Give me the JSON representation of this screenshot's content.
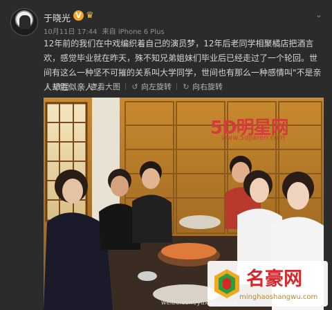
{
  "post": {
    "username": "于晓光",
    "verified_badge": "V",
    "timestamp": "10月11日 17:44",
    "source": "来自 iPhone 6 Plus",
    "content": "12年前的我们在中戏编织着自己的演员梦，12年后老同学相聚橘店把酒言欢，感觉毕业就在昨天，殊不知兄弟姐妹们毕业后已经走过了一个轮回。世间有这么一种坚不可摧的关系叫大学同学，世间也有那么一种感情叫\"不是亲人却胜似亲人\"。"
  },
  "toolbar": {
    "collapse": "收起",
    "view_large": "查看大图",
    "rotate_left": "向左旋转",
    "rotate_right": "向右旋转"
  },
  "icons": {
    "avatar": "user-avatar",
    "verified": "verified-v-badge",
    "crown": "crown-icon",
    "menu": "chevron-down-icon",
    "collapse": "collapse-icon",
    "zoom": "magnifier-icon",
    "rotate_left": "rotate-left-icon",
    "rotate_right": "rotate-right-icon"
  },
  "watermarks": {
    "site1_name": "5D明星网",
    "site1_url": "www.5djiaren.com",
    "site2_name": "名豪网",
    "site2_url": "minghaoshangwu.com",
    "weibo_caption": "weibo.com/yuxiaoguang"
  },
  "colors": {
    "background": "#2b2b2b",
    "text": "#d4d4d4",
    "meta": "#8f8f8f",
    "verified": "#f5a623",
    "watermark_red": "#d43b3b"
  }
}
